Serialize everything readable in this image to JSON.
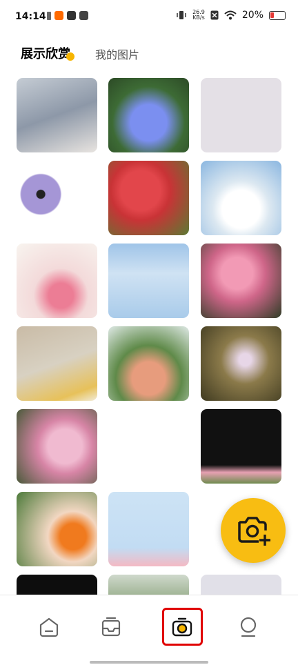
{
  "status_bar": {
    "time": "14:14",
    "network_speed_value": "26.9",
    "network_speed_unit": "KB/s",
    "battery_percent": "20%",
    "battery_color": "#e53935"
  },
  "tabs": [
    {
      "label": "展示欣赏",
      "active": true
    },
    {
      "label": "我的图片",
      "active": false
    }
  ],
  "accent_color": "#f8bd12",
  "gallery": {
    "images": [
      "blurred flowers",
      "blue chicory flower",
      "blank light gray",
      "white anemone flower",
      "red quince blossoms",
      "white roses blue sky",
      "pink flowers vase",
      "sky with branch",
      "pink carnations",
      "blurred yellow flowers",
      "roses bouquet",
      "pink blossom twig",
      "pink hydrangea",
      "empty",
      "pink flowers dark",
      "orange and white roses",
      "light blue sky pink flower",
      "empty",
      "dark image",
      "green leaves",
      "light gray"
    ]
  },
  "fab": {
    "icon": "add-photo-camera-icon"
  },
  "bottom_nav": [
    {
      "icon": "home-icon"
    },
    {
      "icon": "inbox-icon"
    },
    {
      "icon": "camera-icon",
      "active": true
    },
    {
      "icon": "profile-icon"
    }
  ]
}
